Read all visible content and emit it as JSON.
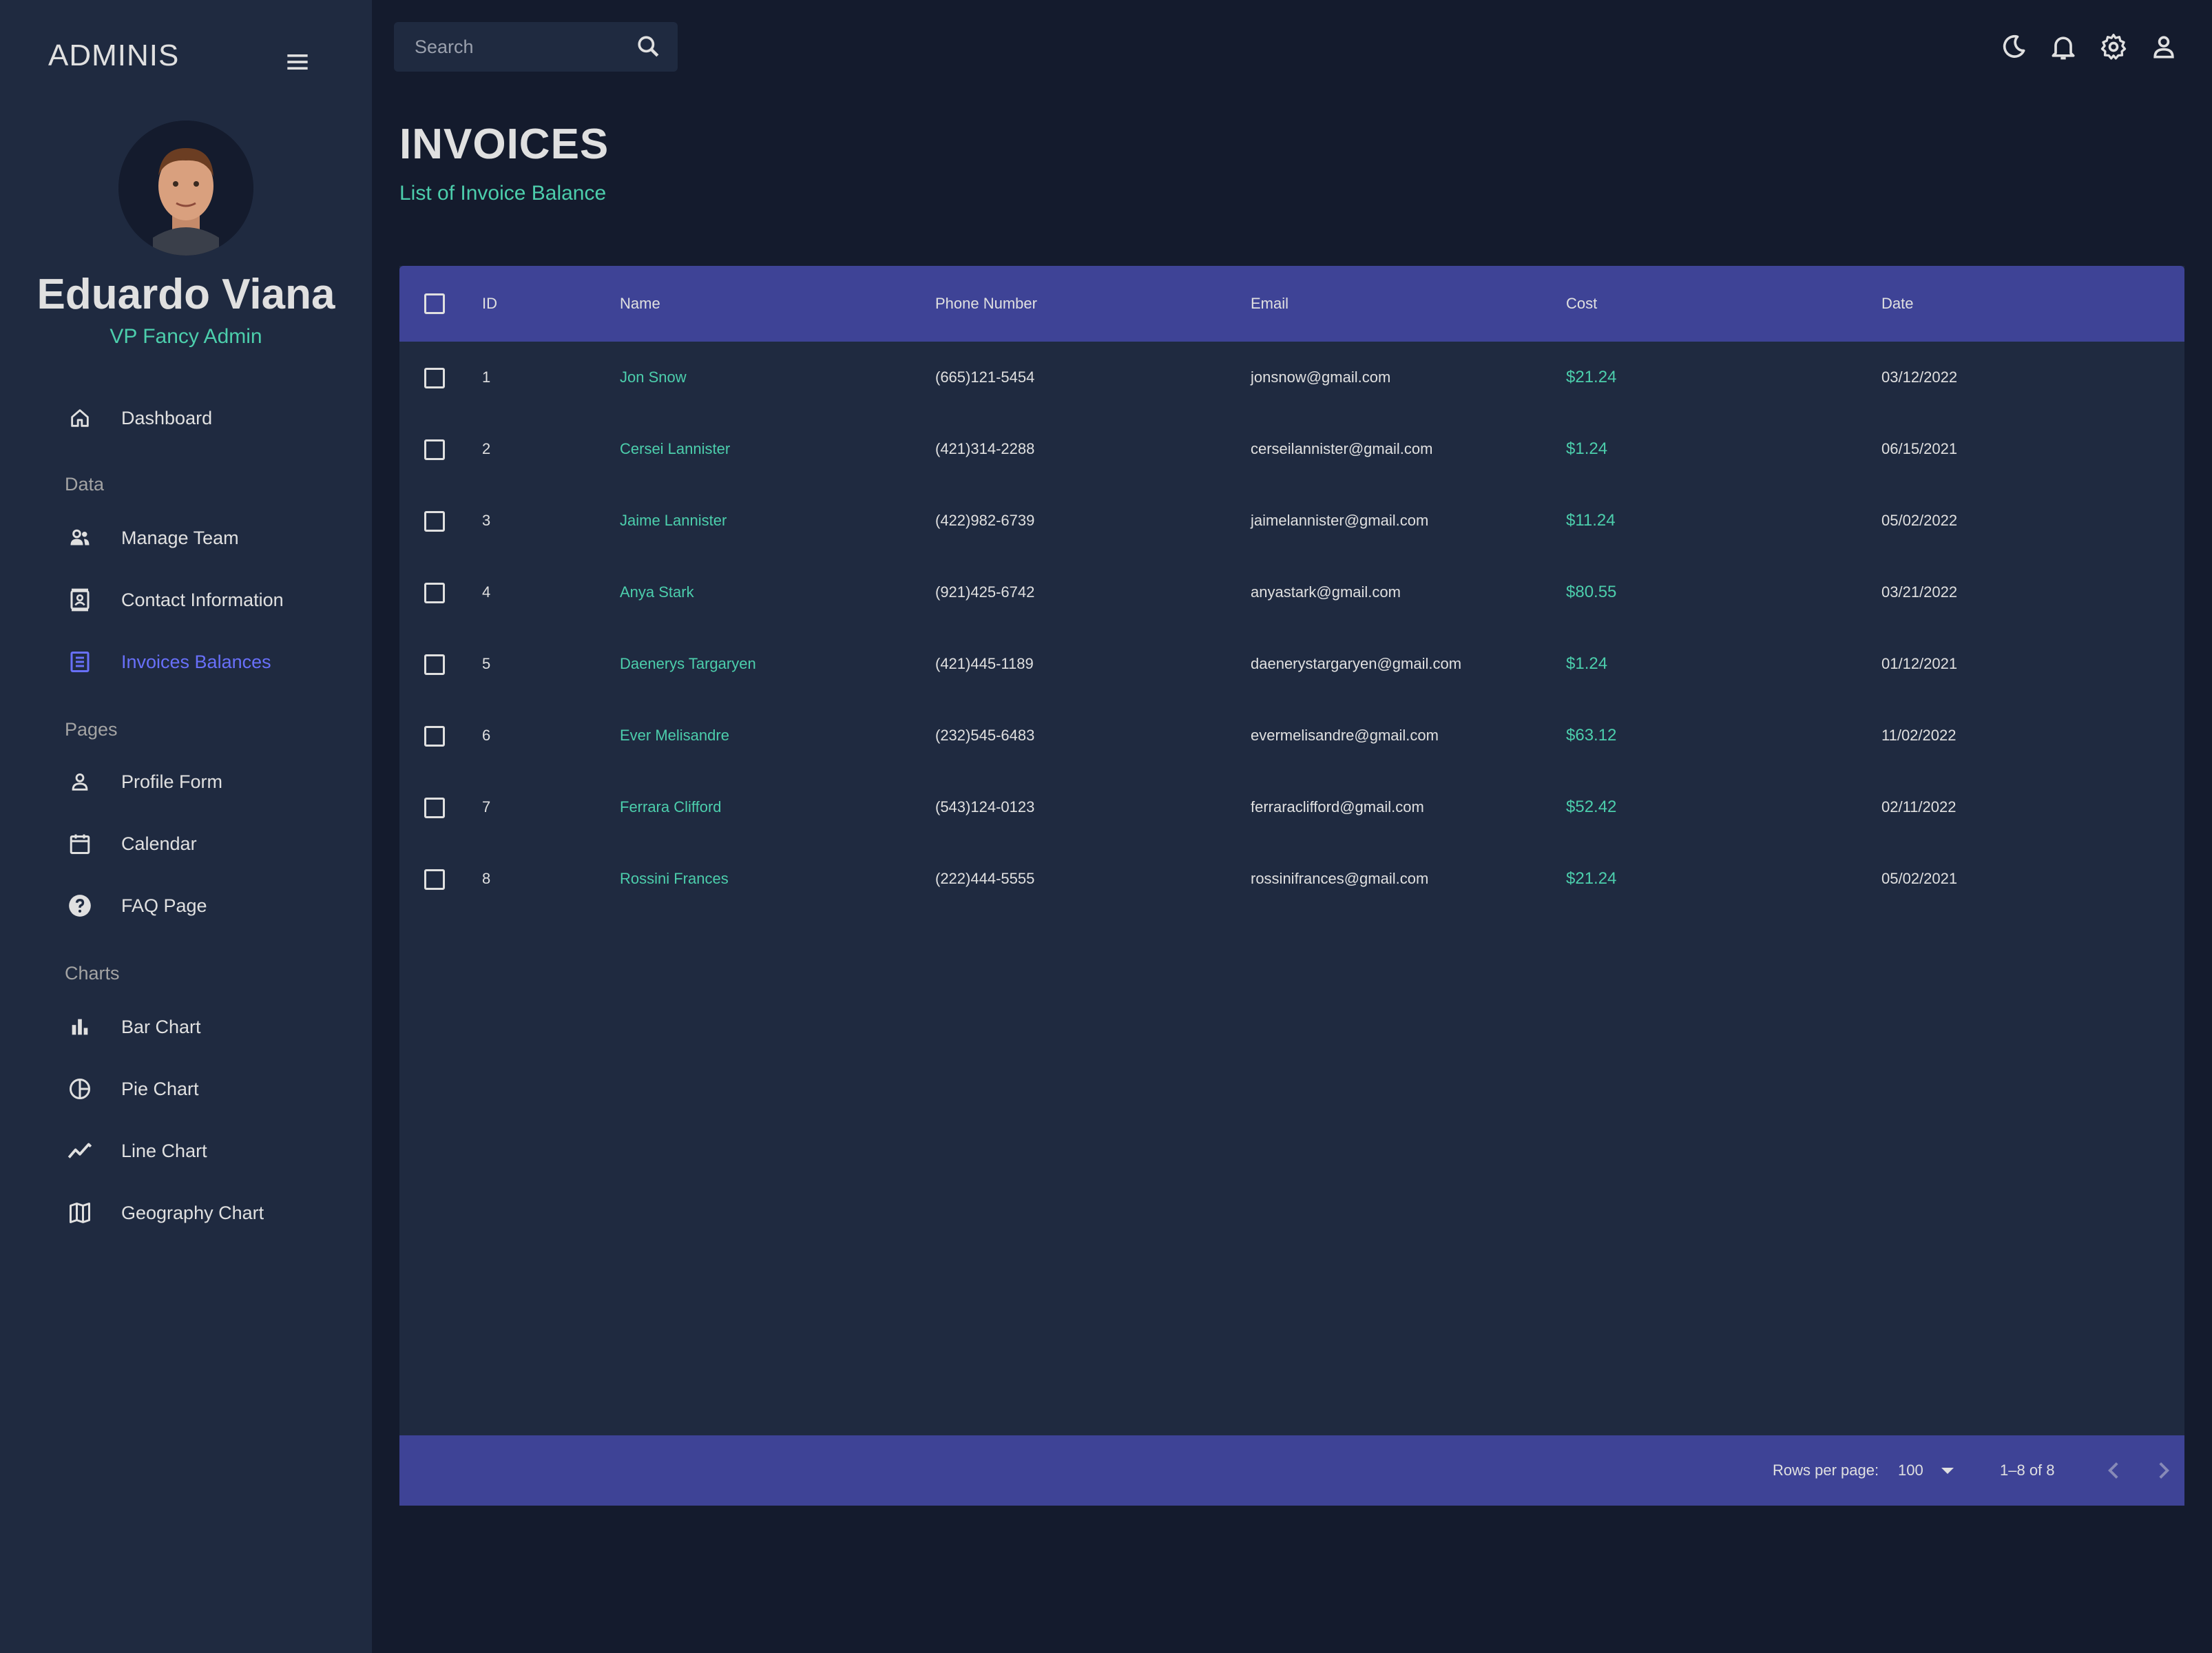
{
  "app": {
    "brand": "ADMINIS"
  },
  "profile": {
    "name": "Eduardo Viana",
    "role": "VP Fancy Admin"
  },
  "sidebar": {
    "dashboard": "Dashboard",
    "sections": {
      "data": "Data",
      "pages": "Pages",
      "charts": "Charts"
    },
    "data_items": [
      "Manage Team",
      "Contact Information",
      "Invoices Balances"
    ],
    "page_items": [
      "Profile Form",
      "Calendar",
      "FAQ Page"
    ],
    "chart_items": [
      "Bar Chart",
      "Pie Chart",
      "Line Chart",
      "Geography Chart"
    ],
    "active_item": "Invoices Balances"
  },
  "topbar": {
    "search_placeholder": "Search",
    "icons": [
      "moon-icon",
      "bell-icon",
      "gear-icon",
      "person-icon"
    ]
  },
  "header": {
    "title": "INVOICES",
    "subtitle": "List of Invoice Balance"
  },
  "table": {
    "columns": [
      "ID",
      "Name",
      "Phone Number",
      "Email",
      "Cost",
      "Date"
    ],
    "rows": [
      {
        "id": "1",
        "name": "Jon Snow",
        "phone": "(665)121-5454",
        "email": "jonsnow@gmail.com",
        "cost": "$21.24",
        "date": "03/12/2022"
      },
      {
        "id": "2",
        "name": "Cersei Lannister",
        "phone": "(421)314-2288",
        "email": "cerseilannister@gmail.com",
        "cost": "$1.24",
        "date": "06/15/2021"
      },
      {
        "id": "3",
        "name": "Jaime Lannister",
        "phone": "(422)982-6739",
        "email": "jaimelannister@gmail.com",
        "cost": "$11.24",
        "date": "05/02/2022"
      },
      {
        "id": "4",
        "name": "Anya Stark",
        "phone": "(921)425-6742",
        "email": "anyastark@gmail.com",
        "cost": "$80.55",
        "date": "03/21/2022"
      },
      {
        "id": "5",
        "name": "Daenerys Targaryen",
        "phone": "(421)445-1189",
        "email": "daenerystargaryen@gmail.com",
        "cost": "$1.24",
        "date": "01/12/2021"
      },
      {
        "id": "6",
        "name": "Ever Melisandre",
        "phone": "(232)545-6483",
        "email": "evermelisandre@gmail.com",
        "cost": "$63.12",
        "date": "11/02/2022"
      },
      {
        "id": "7",
        "name": "Ferrara Clifford",
        "phone": "(543)124-0123",
        "email": "ferraraclifford@gmail.com",
        "cost": "$52.42",
        "date": "02/11/2022"
      },
      {
        "id": "8",
        "name": "Rossini Frances",
        "phone": "(222)444-5555",
        "email": "rossinifrances@gmail.com",
        "cost": "$21.24",
        "date": "05/02/2021"
      }
    ],
    "footer": {
      "rows_per_page_label": "Rows per page:",
      "rows_per_page": "100",
      "page_info": "1–8 of 8"
    }
  },
  "colors": {
    "background": "#141b2d",
    "panel": "#1f2a40",
    "accent_green": "#4cceac",
    "accent_blue": "#3e4396",
    "active_nav": "#6870fa"
  }
}
